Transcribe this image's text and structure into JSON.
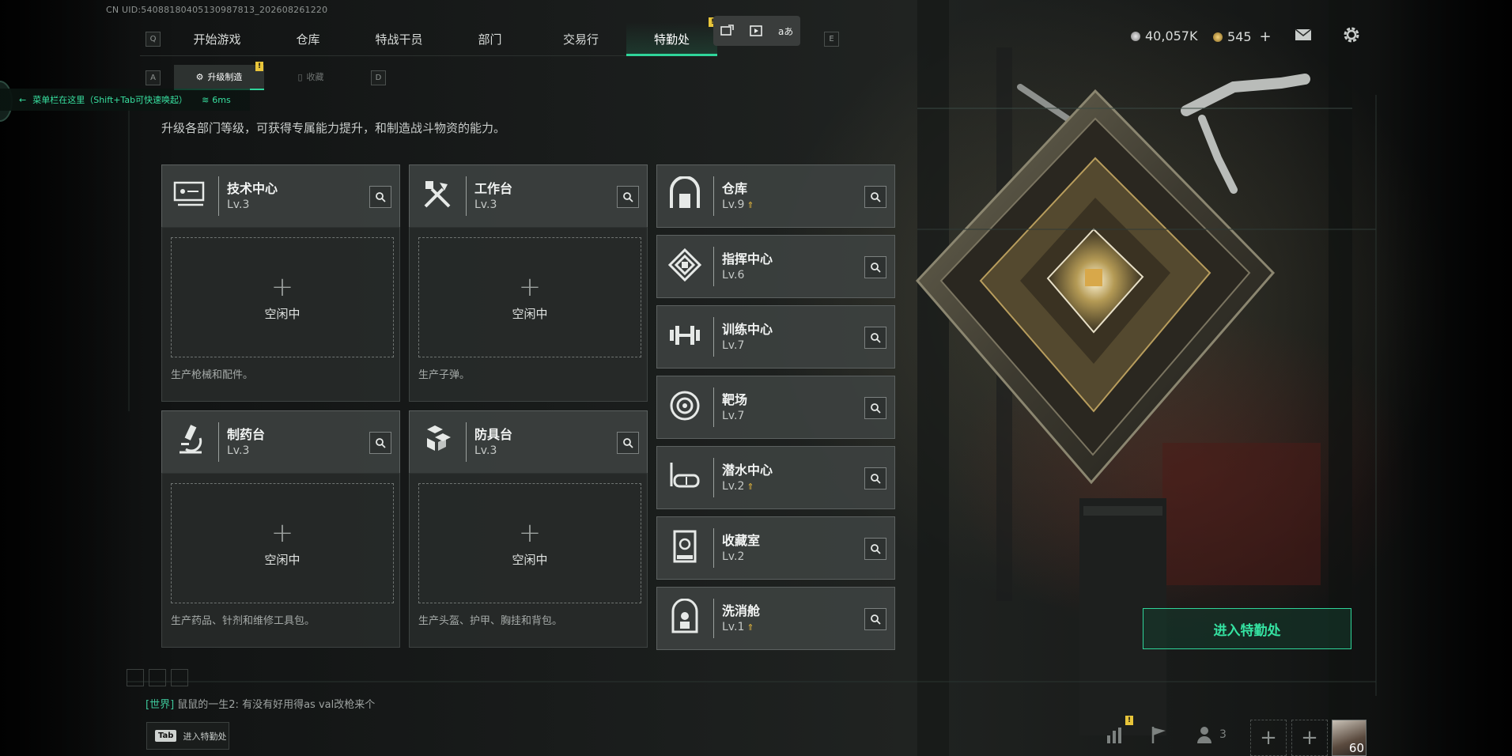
{
  "uid": "CN UID:540881804051309878​13_202608261220",
  "nav": {
    "left_key": "Q",
    "right_key": "E",
    "tabs": [
      "开始游戏",
      "仓库",
      "特战干员",
      "部门",
      "交易行",
      "特勤处"
    ],
    "active_tab": "特勤处"
  },
  "toolbar": {
    "icons": [
      "screenshot-icon",
      "record-icon",
      "translate-icon"
    ]
  },
  "currency": {
    "coins": "40,057K",
    "gems": "545",
    "gems_plus": "+"
  },
  "subtabs": {
    "left_key": "A",
    "right_key": "D",
    "items": [
      {
        "label": "升级制造",
        "active": true
      },
      {
        "label": "收藏",
        "active": false
      }
    ]
  },
  "hint": {
    "text": "菜单栏在这里（Shift+Tab可快速唤起）",
    "ping": "6ms"
  },
  "description": "升级各部门等级，可获得专属能力提升，和制造战斗物资的能力。",
  "production": [
    {
      "name": "技术中心",
      "level": "Lv.3",
      "idle": "空闲中",
      "desc": "生产枪械和配件。",
      "icon": "computer-icon"
    },
    {
      "name": "工作台",
      "level": "Lv.3",
      "idle": "空闲中",
      "desc": "生产子弹。",
      "icon": "tools-icon"
    },
    {
      "name": "制药台",
      "level": "Lv.3",
      "idle": "空闲中",
      "desc": "生产药品、针剂和维修工具包。",
      "icon": "microscope-icon"
    },
    {
      "name": "防具台",
      "level": "Lv.3",
      "idle": "空闲中",
      "desc": "生产头盔、护甲、胸挂和背包。",
      "icon": "cubes-icon"
    }
  ],
  "departments": [
    {
      "name": "仓库",
      "level": "Lv.9",
      "upgrade": true,
      "icon": "warehouse-icon"
    },
    {
      "name": "指挥中心",
      "level": "Lv.6",
      "upgrade": false,
      "icon": "command-icon"
    },
    {
      "name": "训练中心",
      "level": "Lv.7",
      "upgrade": false,
      "icon": "dumbbell-icon"
    },
    {
      "name": "靶场",
      "level": "Lv.7",
      "upgrade": false,
      "icon": "target-icon"
    },
    {
      "name": "潜水中心",
      "level": "Lv.2",
      "upgrade": true,
      "icon": "goggles-icon"
    },
    {
      "name": "收藏室",
      "level": "Lv.2",
      "upgrade": false,
      "icon": "display-case-icon"
    },
    {
      "name": "洗消舱",
      "level": "Lv.1",
      "upgrade": true,
      "icon": "decon-icon"
    }
  ],
  "enter_button": "进入特勤处",
  "chat": {
    "channel": "[世界]",
    "message": " 鼠鼠的一生2: 有没有好用得as  val改枪来个"
  },
  "tab_hint": {
    "key": "Tab",
    "label": "进入特勤处"
  },
  "bottom": {
    "squad_count": "3",
    "level": "60"
  },
  "colors": {
    "accent": "#2fd59a",
    "upgrade": "#e3b63c",
    "card": "#3e4241"
  }
}
